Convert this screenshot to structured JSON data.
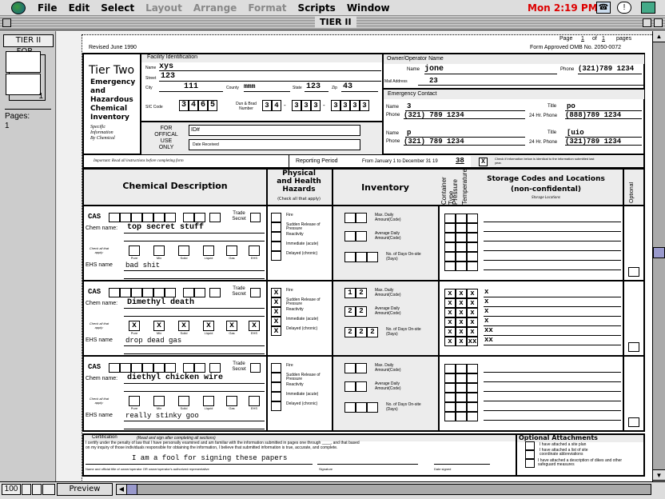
{
  "menubar": {
    "items": [
      {
        "label": "File",
        "enabled": true
      },
      {
        "label": "Edit",
        "enabled": true
      },
      {
        "label": "Select",
        "enabled": true
      },
      {
        "label": "Layout",
        "enabled": false
      },
      {
        "label": "Arrange",
        "enabled": false
      },
      {
        "label": "Format",
        "enabled": false
      },
      {
        "label": "Scripts",
        "enabled": true
      },
      {
        "label": "Window",
        "enabled": true
      }
    ],
    "clock": "Mon 2:19 PM",
    "icons": [
      "apple-globe-icon",
      "phone-icon",
      "alert-balloon-icon",
      "app-switcher-icon"
    ],
    "clock_color": "#dd0000"
  },
  "window": {
    "title": "TIER II"
  },
  "sidebar": {
    "layout_button": "TIER II FOR...",
    "page_number": "1",
    "pages_label": "Pages:",
    "pages_value": "1"
  },
  "statusbar": {
    "zoom": "100",
    "mode": "Preview"
  },
  "form": {
    "revised": "Revised June 1990",
    "page_label": "Page",
    "page_num": "1",
    "of_label": "of",
    "page_total": "1",
    "pages_label": "pages",
    "omb": "Form Approved OMB No. 2050-0072",
    "title": "Tier Two",
    "subtitle": [
      "Emergency",
      "and",
      "Hazardous",
      "Chemical",
      "Inventory"
    ],
    "specific": [
      "Specific",
      "Information",
      "By Chemical"
    ],
    "facility": {
      "header": "Facility Identification",
      "name_label": "Name",
      "name": "xys",
      "street_label": "Street",
      "street": "123",
      "city_label": "City",
      "city": "111",
      "county_label": "County",
      "county": "mmm",
      "state_label": "State",
      "state": "123",
      "zip_label": "Zip",
      "zip": "43",
      "sic_label": "SIC Code",
      "sic": [
        "3",
        "4",
        "6",
        "5"
      ],
      "dun_label": "Dun & Brad Number",
      "dun": [
        "3",
        "4",
        "3",
        "3",
        "3",
        "3",
        "3",
        "3",
        "3"
      ]
    },
    "official": {
      "label": [
        "FOR",
        "OFFICAL",
        "USE",
        "ONLY"
      ],
      "id_label": "ID#",
      "date_label": "Date Received"
    },
    "owner": {
      "header": "Owner/Operator Name",
      "name_label": "Name",
      "name": "jone",
      "phone_label": "Phone",
      "phone": "(321)789 1234",
      "mail_label": "Mail Address",
      "mail": "23"
    },
    "emergency": {
      "header": "Emergency Contact",
      "contacts": [
        {
          "name_label": "Name",
          "name": "3",
          "title_label": "Title",
          "title": "po",
          "phone_label": "Phone",
          "phone": "(321) 789 1234",
          "hr24_label": "24 Hr. Phone",
          "hr24": "(888)789 1234"
        },
        {
          "name_label": "Name",
          "name": "p",
          "title_label": "Title",
          "title": "[uio",
          "phone_label": "Phone",
          "phone": "(321) 789 1234",
          "hr24_label": "24 Hr. Phone",
          "hr24": "(321)789 1234"
        }
      ]
    },
    "important": "Important: Read all instructions before completing form",
    "reporting_label": "Reporting Period",
    "reporting_text": "From January 1 to December 31 19",
    "reporting_year": "38",
    "identical_check": "X",
    "identical_text": "Check if information below is identical to the information submitted last year.",
    "headers": {
      "chemical": "Chemical Description",
      "hazards": [
        "Physical",
        "and Health",
        "Hazards"
      ],
      "hazards_sub": "(Check all that apply)",
      "inventory": "Inventory",
      "container": "Container Type",
      "pressure": "Pressure",
      "temperature": "Temperature",
      "storage": "Storage Codes and Locations",
      "storage_sub": "(non-confidental)",
      "storage_loc": "Storage Locations",
      "optional": "Optional"
    },
    "labels": {
      "cas": "CAS",
      "trade": "Trade Secret",
      "chem_name": "Chem name:",
      "check_all": "Check all that apply:",
      "ehs_name": "EHS name",
      "types": [
        "Pure",
        "Mix",
        "Solid",
        "Liquid",
        "Gas",
        "EHS"
      ],
      "hazards": [
        "Fire",
        "Sudden Release of Pressure",
        "Reactivity",
        "Immediate (acute)",
        "Delayed (chronic)"
      ],
      "max_daily": "Max. Daily Amount(Code)",
      "avg_daily": "Average Daily Amount(Code)",
      "days": "No. of Days On-site (Days)"
    },
    "chemicals": [
      {
        "chem_name": "top secret stuff",
        "ehs_name": "bad shit",
        "types": [
          "",
          "",
          "",
          "",
          "",
          ""
        ],
        "hazards": [
          "",
          "",
          "",
          "",
          ""
        ],
        "max": [
          "",
          ""
        ],
        "avg": [
          "",
          ""
        ],
        "days": [
          "",
          "",
          ""
        ],
        "storage_codes": [
          [
            "",
            "",
            ""
          ],
          [
            "",
            "",
            ""
          ],
          [
            "",
            "",
            ""
          ],
          [
            "",
            "",
            ""
          ],
          [
            "",
            "",
            ""
          ],
          [
            "",
            "",
            ""
          ]
        ],
        "locations": [
          "",
          "",
          "",
          "",
          "",
          ""
        ]
      },
      {
        "chem_name": "Dimethyl death",
        "ehs_name": "drop dead gas",
        "types": [
          "x",
          "x",
          "x",
          "x",
          "x",
          "x"
        ],
        "hazards": [
          "x",
          "x",
          "x",
          "x",
          "x"
        ],
        "max": [
          "1",
          "2"
        ],
        "avg": [
          "2",
          "2"
        ],
        "days": [
          "2",
          "2",
          "2"
        ],
        "storage_codes": [
          [
            "x",
            "x",
            "x"
          ],
          [
            "x",
            "x",
            "x"
          ],
          [
            "x",
            "x",
            "x"
          ],
          [
            "x",
            "x",
            "x"
          ],
          [
            "x",
            "x",
            "x"
          ],
          [
            "x",
            "x",
            "xx"
          ]
        ],
        "locations": [
          "x",
          "x",
          "x",
          "x",
          "xx",
          "xx"
        ]
      },
      {
        "chem_name": "diethyl chicken wire",
        "ehs_name": "really stinky goo",
        "types": [
          "",
          "",
          "",
          "",
          "",
          ""
        ],
        "hazards": [
          "",
          "",
          "",
          "",
          ""
        ],
        "max": [
          "",
          ""
        ],
        "avg": [
          "",
          ""
        ],
        "days": [
          "",
          "",
          ""
        ],
        "storage_codes": [
          [
            "",
            "",
            ""
          ],
          [
            "",
            "",
            ""
          ],
          [
            "",
            "",
            ""
          ],
          [
            "",
            "",
            ""
          ],
          [
            "",
            "",
            ""
          ],
          [
            "",
            "",
            ""
          ]
        ],
        "locations": [
          "",
          "",
          "",
          "",
          "",
          ""
        ]
      }
    ],
    "certification": {
      "header": "Certification",
      "sub": "(Read and sign after completing all sections)",
      "text1": "I certify under the penalty of law that I have personally examined and am familiar with the information submitted in pages one through ____, and that based",
      "text2": "on my inquiry of those individuals responsible for obtaining the information, I believe that submitted information is true, accurate, and complete.",
      "signed_name": "I am a fool for signing these papers",
      "name_caption": "Name and official title of owner/operator OR owner/operator's authorized representative",
      "sig_caption": "Signature",
      "date_caption": "Date signed"
    },
    "attachments": {
      "header": "Optional Attachments",
      "items": [
        "I have attached a site plan",
        "I have attached a list of site coordinate abbreviations",
        "I have attached a description of dikes and other safeguard measures"
      ]
    }
  }
}
